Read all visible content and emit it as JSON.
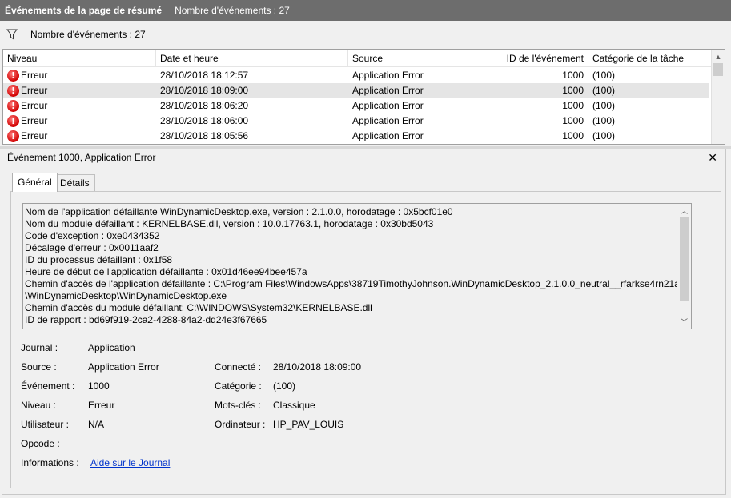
{
  "titlebar": {
    "title": "Événements de la page de résumé",
    "count": "Nombre d'événements : 27"
  },
  "filter": {
    "icon": "filter-icon",
    "count": "Nombre d'événements : 27"
  },
  "events_table": {
    "columns": [
      "Niveau",
      "Date et heure",
      "Source",
      "ID de l'événement",
      "Catégorie de la tâche"
    ],
    "rows": [
      {
        "level": "Erreur",
        "datetime": "28/10/2018 18:12:57",
        "source": "Application Error",
        "id": "1000",
        "category": "(100)"
      },
      {
        "level": "Erreur",
        "datetime": "28/10/2018 18:09:00",
        "source": "Application Error",
        "id": "1000",
        "category": "(100)"
      },
      {
        "level": "Erreur",
        "datetime": "28/10/2018 18:06:20",
        "source": "Application Error",
        "id": "1000",
        "category": "(100)"
      },
      {
        "level": "Erreur",
        "datetime": "28/10/2018 18:06:00",
        "source": "Application Error",
        "id": "1000",
        "category": "(100)"
      },
      {
        "level": "Erreur",
        "datetime": "28/10/2018 18:05:56",
        "source": "Application Error",
        "id": "1000",
        "category": "(100)"
      }
    ],
    "selected_row": 1
  },
  "details": {
    "header": "Événement 1000, Application Error",
    "close_glyph": "✕",
    "tabs": [
      "Général",
      "Détails"
    ],
    "description_lines": [
      "Nom de l'application défaillante WinDynamicDesktop.exe, version : 2.1.0.0, horodatage : 0x5bcf01e0",
      "Nom du module défaillant : KERNELBASE.dll, version : 10.0.17763.1, horodatage : 0x30bd5043",
      "Code d'exception : 0xe0434352",
      "Décalage d'erreur : 0x0011aaf2",
      "ID du processus défaillant : 0x1f58",
      "Heure de début de l'application défaillante : 0x01d46ee94bee457a",
      "Chemin d'accès de l'application défaillante : C:\\Program Files\\WindowsApps\\38719TimothyJohnson.WinDynamicDesktop_2.1.0.0_neutral__rfarkse4rn21a",
      "\\WinDynamicDesktop\\WinDynamicDesktop.exe",
      "Chemin d'accès du module défaillant: C:\\WINDOWS\\System32\\KERNELBASE.dll",
      "ID de rapport : bd69f919-2ca2-4288-84a2-dd24e3f67665"
    ],
    "properties": {
      "journal_label": "Journal :",
      "journal_value": "Application",
      "source_label": "Source :",
      "source_value": "Application Error",
      "connecte_label": "Connecté :",
      "connecte_value": "28/10/2018 18:09:00",
      "evenement_label": "Événement :",
      "evenement_value": "1000",
      "categorie_label": "Catégorie :",
      "categorie_value": "(100)",
      "niveau_label": "Niveau :",
      "niveau_value": "Erreur",
      "motscles_label": "Mots-clés :",
      "motscles_value": "Classique",
      "utilisateur_label": "Utilisateur :",
      "utilisateur_value": "N/A",
      "ordinateur_label": "Ordinateur :",
      "ordinateur_value": "HP_PAV_LOUIS",
      "opcode_label": "Opcode :",
      "opcode_value": "",
      "informations_label": "Informations :",
      "informations_link": "Aide sur le Journal"
    }
  },
  "colors": {
    "titlebar_bg": "#6d6d6d",
    "selected_row": "#e5e5e5",
    "error_red": "#d10000",
    "link": "#0033cc"
  }
}
